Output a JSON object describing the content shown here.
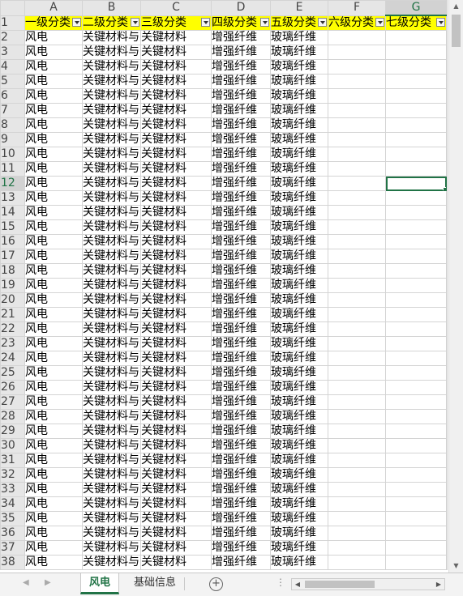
{
  "columns": [
    "A",
    "B",
    "C",
    "D",
    "E",
    "F",
    "G"
  ],
  "selected_column": "G",
  "selected_row": "12",
  "header_row": {
    "row_number": "1",
    "cells": [
      "一级分类",
      "二级分类",
      "三级分类",
      "四级分类",
      "五级分类",
      "六级分类",
      "七级分类"
    ]
  },
  "data_rows": [
    {
      "row_number": "2",
      "cells": [
        "风电",
        "关键材料与",
        "关键材料",
        "增强纤维",
        "玻璃纤维",
        "",
        ""
      ]
    },
    {
      "row_number": "3",
      "cells": [
        "风电",
        "关键材料与",
        "关键材料",
        "增强纤维",
        "玻璃纤维",
        "",
        ""
      ]
    },
    {
      "row_number": "4",
      "cells": [
        "风电",
        "关键材料与",
        "关键材料",
        "增强纤维",
        "玻璃纤维",
        "",
        ""
      ]
    },
    {
      "row_number": "5",
      "cells": [
        "风电",
        "关键材料与",
        "关键材料",
        "增强纤维",
        "玻璃纤维",
        "",
        ""
      ]
    },
    {
      "row_number": "6",
      "cells": [
        "风电",
        "关键材料与",
        "关键材料",
        "增强纤维",
        "玻璃纤维",
        "",
        ""
      ]
    },
    {
      "row_number": "7",
      "cells": [
        "风电",
        "关键材料与",
        "关键材料",
        "增强纤维",
        "玻璃纤维",
        "",
        ""
      ]
    },
    {
      "row_number": "8",
      "cells": [
        "风电",
        "关键材料与",
        "关键材料",
        "增强纤维",
        "玻璃纤维",
        "",
        ""
      ]
    },
    {
      "row_number": "9",
      "cells": [
        "风电",
        "关键材料与",
        "关键材料",
        "增强纤维",
        "玻璃纤维",
        "",
        ""
      ]
    },
    {
      "row_number": "10",
      "cells": [
        "风电",
        "关键材料与",
        "关键材料",
        "增强纤维",
        "玻璃纤维",
        "",
        ""
      ]
    },
    {
      "row_number": "11",
      "cells": [
        "风电",
        "关键材料与",
        "关键材料",
        "增强纤维",
        "玻璃纤维",
        "",
        ""
      ]
    },
    {
      "row_number": "12",
      "cells": [
        "风电",
        "关键材料与",
        "关键材料",
        "增强纤维",
        "玻璃纤维",
        "",
        ""
      ]
    },
    {
      "row_number": "13",
      "cells": [
        "风电",
        "关键材料与",
        "关键材料",
        "增强纤维",
        "玻璃纤维",
        "",
        ""
      ]
    },
    {
      "row_number": "14",
      "cells": [
        "风电",
        "关键材料与",
        "关键材料",
        "增强纤维",
        "玻璃纤维",
        "",
        ""
      ]
    },
    {
      "row_number": "15",
      "cells": [
        "风电",
        "关键材料与",
        "关键材料",
        "增强纤维",
        "玻璃纤维",
        "",
        ""
      ]
    },
    {
      "row_number": "16",
      "cells": [
        "风电",
        "关键材料与",
        "关键材料",
        "增强纤维",
        "玻璃纤维",
        "",
        ""
      ]
    },
    {
      "row_number": "17",
      "cells": [
        "风电",
        "关键材料与",
        "关键材料",
        "增强纤维",
        "玻璃纤维",
        "",
        ""
      ]
    },
    {
      "row_number": "18",
      "cells": [
        "风电",
        "关键材料与",
        "关键材料",
        "增强纤维",
        "玻璃纤维",
        "",
        ""
      ]
    },
    {
      "row_number": "19",
      "cells": [
        "风电",
        "关键材料与",
        "关键材料",
        "增强纤维",
        "玻璃纤维",
        "",
        ""
      ]
    },
    {
      "row_number": "20",
      "cells": [
        "风电",
        "关键材料与",
        "关键材料",
        "增强纤维",
        "玻璃纤维",
        "",
        ""
      ]
    },
    {
      "row_number": "21",
      "cells": [
        "风电",
        "关键材料与",
        "关键材料",
        "增强纤维",
        "玻璃纤维",
        "",
        ""
      ]
    },
    {
      "row_number": "22",
      "cells": [
        "风电",
        "关键材料与",
        "关键材料",
        "增强纤维",
        "玻璃纤维",
        "",
        ""
      ]
    },
    {
      "row_number": "23",
      "cells": [
        "风电",
        "关键材料与",
        "关键材料",
        "增强纤维",
        "玻璃纤维",
        "",
        ""
      ]
    },
    {
      "row_number": "24",
      "cells": [
        "风电",
        "关键材料与",
        "关键材料",
        "增强纤维",
        "玻璃纤维",
        "",
        ""
      ]
    },
    {
      "row_number": "25",
      "cells": [
        "风电",
        "关键材料与",
        "关键材料",
        "增强纤维",
        "玻璃纤维",
        "",
        ""
      ]
    },
    {
      "row_number": "26",
      "cells": [
        "风电",
        "关键材料与",
        "关键材料",
        "增强纤维",
        "玻璃纤维",
        "",
        ""
      ]
    },
    {
      "row_number": "27",
      "cells": [
        "风电",
        "关键材料与",
        "关键材料",
        "增强纤维",
        "玻璃纤维",
        "",
        ""
      ]
    },
    {
      "row_number": "28",
      "cells": [
        "风电",
        "关键材料与",
        "关键材料",
        "增强纤维",
        "玻璃纤维",
        "",
        ""
      ]
    },
    {
      "row_number": "29",
      "cells": [
        "风电",
        "关键材料与",
        "关键材料",
        "增强纤维",
        "玻璃纤维",
        "",
        ""
      ]
    },
    {
      "row_number": "30",
      "cells": [
        "风电",
        "关键材料与",
        "关键材料",
        "增强纤维",
        "玻璃纤维",
        "",
        ""
      ]
    },
    {
      "row_number": "31",
      "cells": [
        "风电",
        "关键材料与",
        "关键材料",
        "增强纤维",
        "玻璃纤维",
        "",
        ""
      ]
    },
    {
      "row_number": "32",
      "cells": [
        "风电",
        "关键材料与",
        "关键材料",
        "增强纤维",
        "玻璃纤维",
        "",
        ""
      ]
    },
    {
      "row_number": "33",
      "cells": [
        "风电",
        "关键材料与",
        "关键材料",
        "增强纤维",
        "玻璃纤维",
        "",
        ""
      ]
    },
    {
      "row_number": "34",
      "cells": [
        "风电",
        "关键材料与",
        "关键材料",
        "增强纤维",
        "玻璃纤维",
        "",
        ""
      ]
    },
    {
      "row_number": "35",
      "cells": [
        "风电",
        "关键材料与",
        "关键材料",
        "增强纤维",
        "玻璃纤维",
        "",
        ""
      ]
    },
    {
      "row_number": "36",
      "cells": [
        "风电",
        "关键材料与",
        "关键材料",
        "增强纤维",
        "玻璃纤维",
        "",
        ""
      ]
    },
    {
      "row_number": "37",
      "cells": [
        "风电",
        "关键材料与",
        "关键材料",
        "增强纤维",
        "玻璃纤维",
        "",
        ""
      ]
    },
    {
      "row_number": "38",
      "cells": [
        "风电",
        "关键材料与",
        "关键材料",
        "增强纤维",
        "玻璃纤维",
        "",
        ""
      ]
    }
  ],
  "sheet_tabs": {
    "active": "风电",
    "other": "基础信息"
  },
  "colors": {
    "header_fill": "#ffff00",
    "accent": "#217346"
  },
  "icons": {
    "filter": "filter-dropdown-icon",
    "add_sheet": "plus-circle-icon"
  }
}
